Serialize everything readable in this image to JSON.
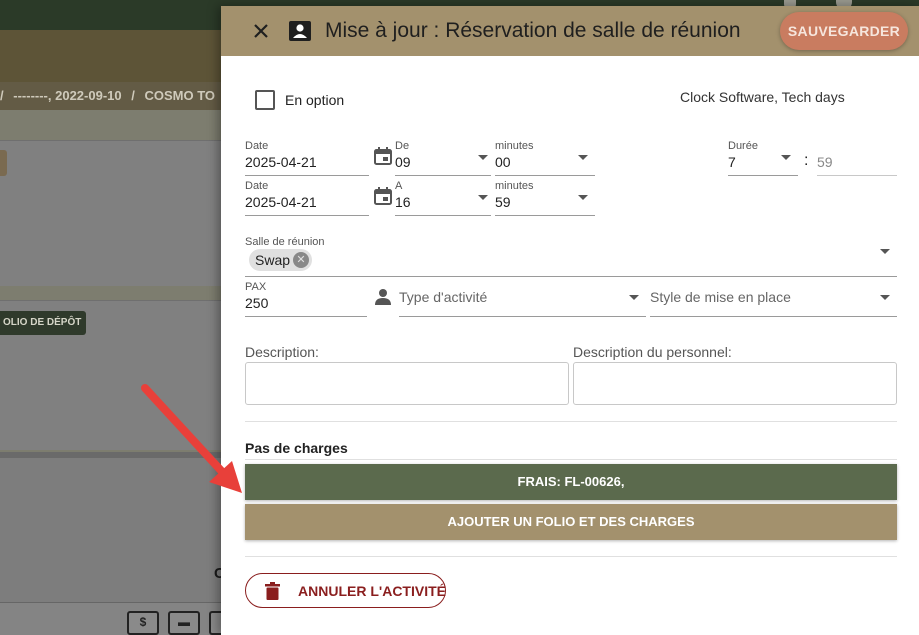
{
  "background": {
    "breadcrumb": [
      "/",
      "--------, 2022-09-10",
      "/",
      "COSMO TO"
    ],
    "folio_badge": "OLIO DE DÉPÔT",
    "partial_text": "C"
  },
  "dialog": {
    "title": "Mise à jour : Réservation de salle de réunion",
    "save_label": "SAUVEGARDER",
    "option_label": "En option",
    "client": "Clock Software, Tech days",
    "start": {
      "date_label": "Date",
      "date_value": "2025-04-21",
      "hour_label": "De",
      "hour_value": "09",
      "minutes_label": "minutes",
      "minutes_value": "00"
    },
    "end": {
      "date_label": "Date",
      "date_value": "2025-04-21",
      "hour_label": "A",
      "hour_value": "16",
      "minutes_label": "minutes",
      "minutes_value": "59"
    },
    "duration": {
      "label": "Durée",
      "hours": "7",
      "separator": ":",
      "minutes": "59"
    },
    "room": {
      "label": "Salle de réunion",
      "chip": "Swap"
    },
    "pax": {
      "label": "PAX",
      "value": "250"
    },
    "activity_type_placeholder": "Type d'activité",
    "setup_style_placeholder": "Style de mise en place",
    "description_label": "Description:",
    "staff_description_label": "Description du personnel:",
    "charges_title": "Pas de charges",
    "frais_label": "FRAIS: FL-00626,",
    "add_folio_label": "AJOUTER UN FOLIO ET DES CHARGES",
    "cancel_label": "ANNULER L'ACTIVITÉ"
  },
  "colors": {
    "header": "#a3916d",
    "save": "#c97c60",
    "frais": "#5b6a4d",
    "cancel": "#8a1e1e",
    "arrow": "#e8403a"
  }
}
